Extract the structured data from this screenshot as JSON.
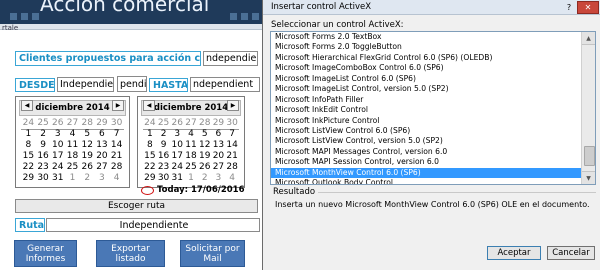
{
  "banner": {
    "title": "Acción comercial"
  },
  "edge_label": "rtale",
  "form": {
    "clients_label": "Clientes propuestos para acción comercial:",
    "clients_value": "ndependien",
    "desde_label": "DESDE:",
    "desde_value": "Independiente",
    "middle_value": "pendie",
    "hasta_label": "HASTA:",
    "hasta_value": "ndependient",
    "calendar_left": {
      "month": "diciembre 2014",
      "rows": [
        [
          "24",
          "25",
          "26",
          "27",
          "28",
          "29",
          "30"
        ],
        [
          "1",
          "2",
          "3",
          "4",
          "5",
          "6",
          "7"
        ],
        [
          "8",
          "9",
          "10",
          "11",
          "12",
          "13",
          "14"
        ],
        [
          "15",
          "16",
          "17",
          "18",
          "19",
          "20",
          "21"
        ],
        [
          "22",
          "23",
          "24",
          "25",
          "26",
          "27",
          "28"
        ],
        [
          "29",
          "30",
          "31",
          "1",
          "2",
          "3",
          "4"
        ]
      ]
    },
    "calendar_right": {
      "month": "diciembre 2014",
      "rows": [
        [
          "24",
          "25",
          "26",
          "27",
          "28",
          "29",
          "30"
        ],
        [
          "1",
          "2",
          "3",
          "4",
          "5",
          "6",
          "7"
        ],
        [
          "8",
          "9",
          "10",
          "11",
          "12",
          "13",
          "14"
        ],
        [
          "15",
          "16",
          "17",
          "18",
          "19",
          "20",
          "21"
        ],
        [
          "22",
          "23",
          "24",
          "25",
          "26",
          "27",
          "28"
        ],
        [
          "29",
          "30",
          "31",
          "1",
          "2",
          "3",
          "4"
        ]
      ]
    },
    "today_label": "Today: 17/06/2016",
    "escoger_button": "Escoger ruta",
    "ruta_label": "Ruta:",
    "ruta_value": "Independiente",
    "btn_generar": "Generar Informes",
    "btn_exportar": "Exportar listado",
    "btn_solicitar": "Solicitar por Mail"
  },
  "dialog": {
    "title": "Insertar control ActiveX",
    "help_label": "?",
    "close_label": "✕",
    "prompt": "Seleccionar un control ActiveX:",
    "items": [
      "Microsoft Forms 2.0 TextBox",
      "Microsoft Forms 2.0 ToggleButton",
      "Microsoft Hierarchical FlexGrid Control 6.0 (SP6) (OLEDB)",
      "Microsoft ImageComboBox Control 6.0 (SP6)",
      "Microsoft ImageList Control 6.0 (SP6)",
      "Microsoft ImageList Control, version 5.0 (SP2)",
      "Microsoft InfoPath Filler",
      "Microsoft InkEdit Control",
      "Microsoft InkPicture Control",
      "Microsoft ListView Control 6.0 (SP6)",
      "Microsoft ListView Control, version 5.0 (SP2)",
      "Microsoft MAPI Messages Control, version 6.0",
      "Microsoft MAPI Session Control, version 6.0",
      "Microsoft MonthView Control 6.0 (SP6)",
      "Microsoft Outlook Body Control"
    ],
    "selected_index": 13,
    "resultado_label": "Resultado",
    "resultado_text": "Inserta un nuevo Microsoft MonthView Control 6.0 (SP6) OLE en el documento.",
    "ok_button": "Aceptar",
    "cancel_button": "Cancelar"
  }
}
